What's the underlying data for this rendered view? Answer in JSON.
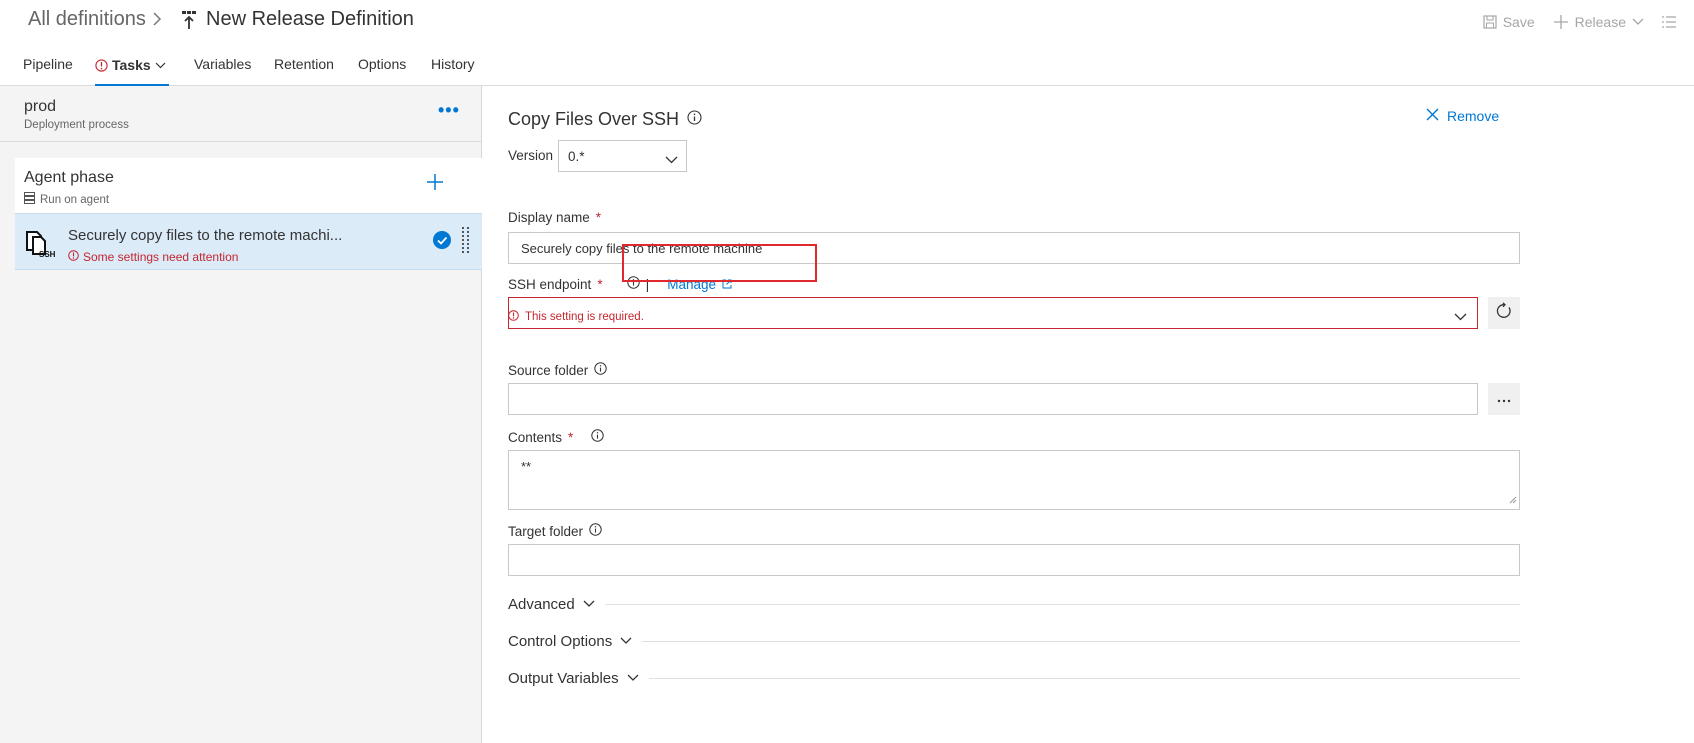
{
  "header": {
    "breadcrumb_root": "All definitions",
    "breadcrumb_sep": ">",
    "title": "New Release Definition",
    "save_label": "Save",
    "release_label": "Release"
  },
  "tabs": [
    {
      "label": "Pipeline"
    },
    {
      "label": "Tasks"
    },
    {
      "label": "Variables"
    },
    {
      "label": "Retention"
    },
    {
      "label": "Options"
    },
    {
      "label": "History"
    }
  ],
  "left": {
    "stage_name": "prod",
    "stage_sub": "Deployment process",
    "more": "•••",
    "phase_name": "Agent phase",
    "phase_sub": "Run on agent",
    "task_name": "Securely copy files to the remote machi...",
    "task_warning": "Some settings need attention"
  },
  "task": {
    "title": "Copy Files Over SSH",
    "remove_label": "Remove",
    "version_label": "Version",
    "version_value": "0.*",
    "display_name_label": "Display name",
    "display_name_value": "Securely copy files to the remote machine",
    "ssh_label": "SSH endpoint",
    "manage_label": "Manage",
    "ssh_value": "",
    "error_text": "This setting is required.",
    "source_label": "Source folder",
    "source_value": "",
    "contents_label": "Contents",
    "contents_value": "**",
    "target_label": "Target folder",
    "target_value": "",
    "sections": [
      "Advanced",
      "Control Options",
      "Output Variables"
    ]
  },
  "colors": {
    "accent": "#0078d4",
    "error": "#c5262f",
    "highlight_box": "#e0282d"
  }
}
